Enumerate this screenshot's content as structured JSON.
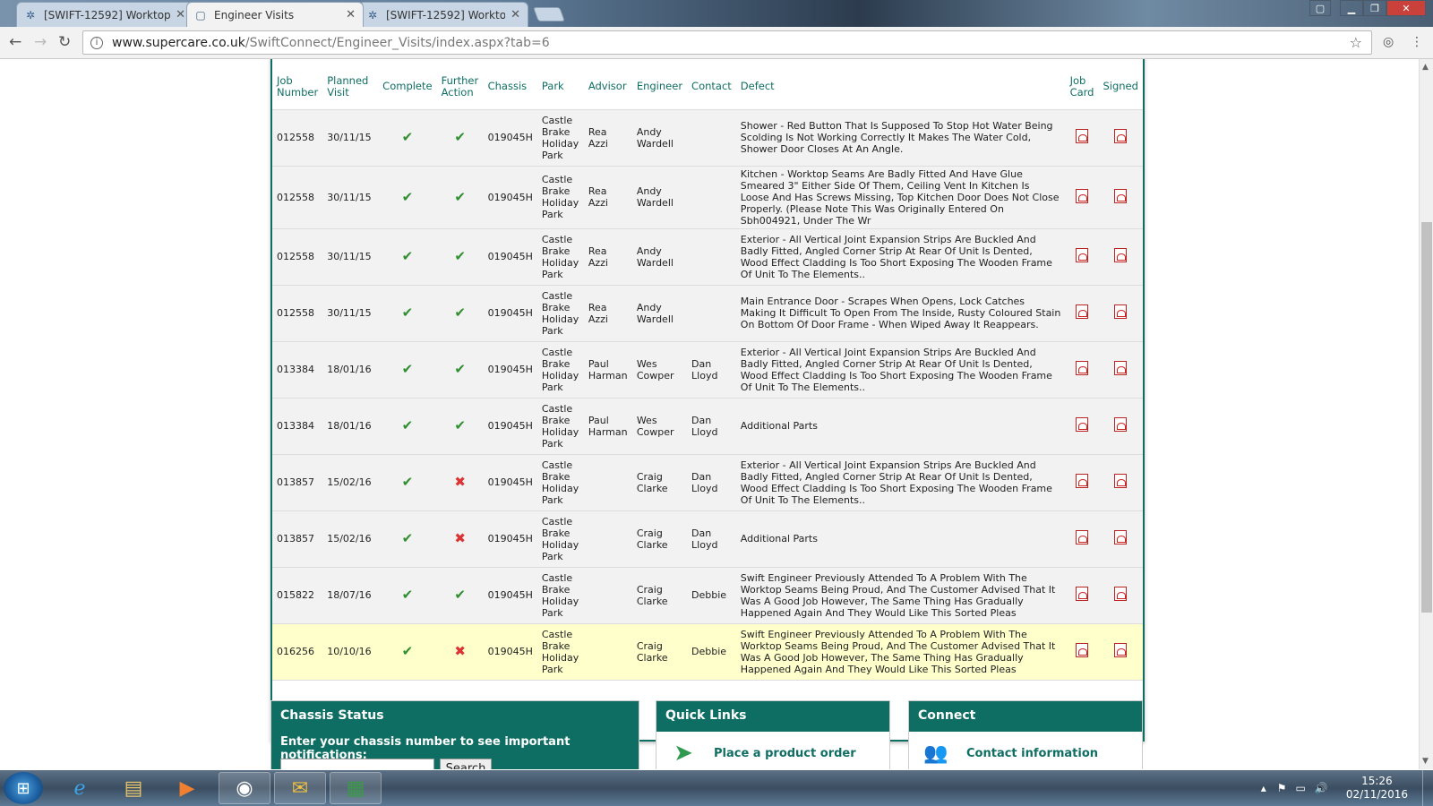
{
  "browser": {
    "tabs": [
      {
        "title": "[SWIFT-12592] Worktop",
        "icon": "jira-icon",
        "active": false
      },
      {
        "title": "Engineer Visits",
        "icon": "page-icon",
        "active": true
      },
      {
        "title": "[SWIFT-12592] Worktop",
        "icon": "jira-icon",
        "active": false
      }
    ],
    "url_host": "www.supercare.co.uk",
    "url_path": "/SwiftConnect/Engineer_Visits/index.aspx?tab=6"
  },
  "table": {
    "headers": [
      "Job Number",
      "Planned Visit",
      "Complete",
      "Further Action",
      "Chassis",
      "Park",
      "Advisor",
      "Engineer",
      "Contact",
      "Defect",
      "Job Card",
      "Signed"
    ],
    "rows": [
      {
        "job": "012558",
        "visit": "30/11/15",
        "complete": true,
        "further": true,
        "chassis": "019045H",
        "park": "Castle Brake Holiday Park",
        "advisor": "Rea Azzi",
        "engineer": "Andy Wardell",
        "contact": "",
        "defect": "Shower - Red Button That Is Supposed To Stop Hot Water Being Scolding Is Not Working Correctly It Makes The Water Cold, Shower Door Closes At An Angle.",
        "highlight": false
      },
      {
        "job": "012558",
        "visit": "30/11/15",
        "complete": true,
        "further": true,
        "chassis": "019045H",
        "park": "Castle Brake Holiday Park",
        "advisor": "Rea Azzi",
        "engineer": "Andy Wardell",
        "contact": "",
        "defect": "Kitchen - Worktop Seams Are Badly Fitted And Have Glue Smeared 3\" Either Side Of Them, Ceiling Vent In Kitchen Is Loose And Has Screws Missing, Top Kitchen Door Does Not Close Properly. (Please Note This Was Originally Entered On Sbh004921, Under The Wr",
        "highlight": false
      },
      {
        "job": "012558",
        "visit": "30/11/15",
        "complete": true,
        "further": true,
        "chassis": "019045H",
        "park": "Castle Brake Holiday Park",
        "advisor": "Rea Azzi",
        "engineer": "Andy Wardell",
        "contact": "",
        "defect": "Exterior - All Vertical Joint Expansion Strips Are Buckled And Badly Fitted, Angled Corner Strip At Rear Of Unit Is Dented, Wood Effect Cladding Is Too Short Exposing The Wooden Frame Of Unit To The Elements..",
        "highlight": false
      },
      {
        "job": "012558",
        "visit": "30/11/15",
        "complete": true,
        "further": true,
        "chassis": "019045H",
        "park": "Castle Brake Holiday Park",
        "advisor": "Rea Azzi",
        "engineer": "Andy Wardell",
        "contact": "",
        "defect": "Main Entrance Door - Scrapes When Opens, Lock Catches Making It Difficult To Open From The Inside, Rusty Coloured Stain On Bottom Of Door Frame - When Wiped Away It Reappears.",
        "highlight": false
      },
      {
        "job": "013384",
        "visit": "18/01/16",
        "complete": true,
        "further": true,
        "chassis": "019045H",
        "park": "Castle Brake Holiday Park",
        "advisor": "Paul Harman",
        "engineer": "Wes Cowper",
        "contact": "Dan Lloyd",
        "defect": "Exterior - All Vertical Joint Expansion Strips Are Buckled And Badly Fitted, Angled Corner Strip At Rear Of Unit Is Dented, Wood Effect Cladding Is Too Short Exposing The Wooden Frame Of Unit To The Elements..",
        "highlight": false
      },
      {
        "job": "013384",
        "visit": "18/01/16",
        "complete": true,
        "further": true,
        "chassis": "019045H",
        "park": "Castle Brake Holiday Park",
        "advisor": "Paul Harman",
        "engineer": "Wes Cowper",
        "contact": "Dan Lloyd",
        "defect": "Additional Parts",
        "highlight": false
      },
      {
        "job": "013857",
        "visit": "15/02/16",
        "complete": true,
        "further": false,
        "chassis": "019045H",
        "park": "Castle Brake Holiday Park",
        "advisor": "",
        "engineer": "Craig Clarke",
        "contact": "Dan Lloyd",
        "defect": "Exterior - All Vertical Joint Expansion Strips Are Buckled And Badly Fitted, Angled Corner Strip At Rear Of Unit Is Dented, Wood Effect Cladding Is Too Short Exposing The Wooden Frame Of Unit To The Elements..",
        "highlight": false
      },
      {
        "job": "013857",
        "visit": "15/02/16",
        "complete": true,
        "further": false,
        "chassis": "019045H",
        "park": "Castle Brake Holiday Park",
        "advisor": "",
        "engineer": "Craig Clarke",
        "contact": "Dan Lloyd",
        "defect": "Additional Parts",
        "highlight": false
      },
      {
        "job": "015822",
        "visit": "18/07/16",
        "complete": true,
        "further": true,
        "chassis": "019045H",
        "park": "Castle Brake Holiday Park",
        "advisor": "",
        "engineer": "Craig Clarke",
        "contact": "Debbie",
        "defect": "Swift Engineer Previously Attended To A Problem With The Worktop Seams Being Proud, And The Customer Advised That It Was A Good Job However, The Same Thing Has Gradually Happened Again And They Would Like This Sorted Pleas",
        "highlight": false
      },
      {
        "job": "016256",
        "visit": "10/10/16",
        "complete": true,
        "further": false,
        "chassis": "019045H",
        "park": "Castle Brake Holiday Park",
        "advisor": "",
        "engineer": "Craig Clarke",
        "contact": "Debbie",
        "defect": "Swift Engineer Previously Attended To A Problem With The Worktop Seams Being Proud, And The Customer Advised That It Was A Good Job However, The Same Thing Has Gradually Happened Again And They Would Like This Sorted Pleas",
        "highlight": true
      }
    ]
  },
  "chassis_status": {
    "title": "Chassis Status",
    "prompt": "Enter your chassis number to see important notifications:",
    "search_label": "Search"
  },
  "quick_links": {
    "title": "Quick Links",
    "item": "Place a product order"
  },
  "connect": {
    "title": "Connect",
    "item": "Contact information"
  },
  "taskbar": {
    "time": "15:26",
    "date": "02/11/2016"
  },
  "colors": {
    "brand": "#0f6e63",
    "highlight_row": "#ffffcc",
    "tick": "#2f8f2f",
    "cross": "#d33"
  }
}
